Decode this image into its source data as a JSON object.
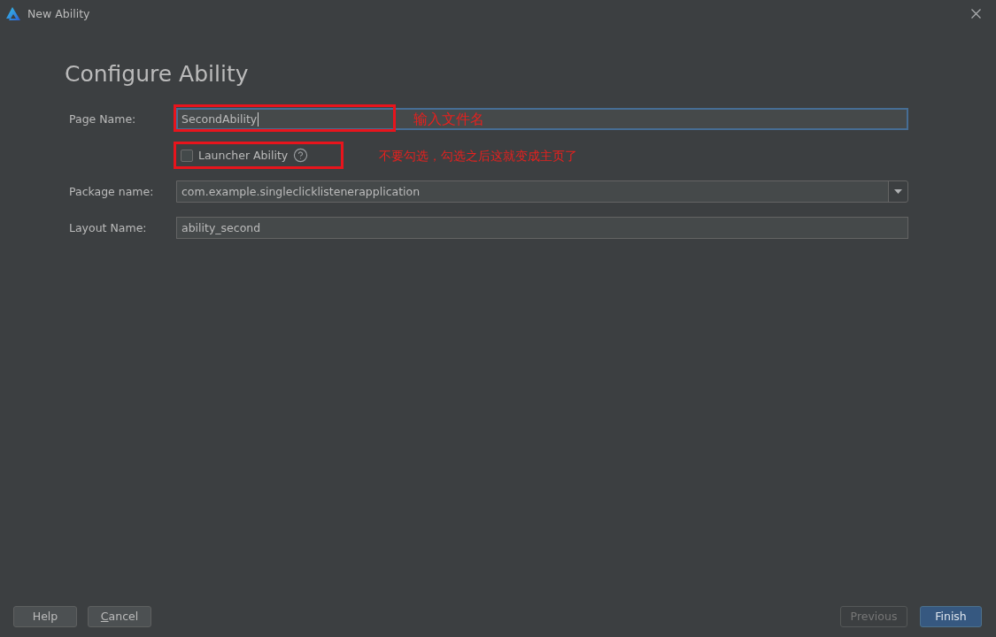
{
  "window": {
    "title": "New Ability"
  },
  "heading": "Configure Ability",
  "form": {
    "fields": [
      {
        "kind": "text",
        "label": "Page Name:",
        "value": "SecondAbility",
        "focused": true,
        "marked": true,
        "note": "输入文件名"
      },
      {
        "kind": "checkbox",
        "label": "Launcher Ability",
        "checked": false,
        "marked": true,
        "note": "不要勾选，勾选之后这就变成主页了"
      },
      {
        "kind": "dropdown",
        "label": "Package name:",
        "value": "com.example.singleclicklistenerapplication",
        "marked": false
      },
      {
        "kind": "text",
        "label": "Layout Name:",
        "value": "ability_second",
        "focused": false,
        "marked": false
      }
    ]
  },
  "buttons_left": [
    {
      "label": "Help",
      "mnemonic": false
    },
    {
      "label": "Cancel",
      "mnemonic": true
    }
  ],
  "buttons_right": [
    {
      "label": "Previous",
      "disabled": true,
      "primary": false
    },
    {
      "label": "Finish",
      "disabled": false,
      "primary": true
    }
  ]
}
